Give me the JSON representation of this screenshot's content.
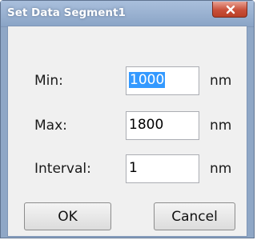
{
  "dialog": {
    "title": "Set Data Segment1",
    "close_label": "×"
  },
  "fields": {
    "min": {
      "label": "Min:",
      "value": "1000",
      "unit": "nm"
    },
    "max": {
      "label": "Max:",
      "value": "1800",
      "unit": "nm"
    },
    "interval": {
      "label": "Interval:",
      "value": "1",
      "unit": "nm"
    }
  },
  "buttons": {
    "ok_label": "OK",
    "cancel_label": "Cancel"
  },
  "colors": {
    "selection": "#3399ff",
    "close_button": "#c9503a",
    "title_bar": "#8fa7c6"
  },
  "icons": {
    "close": "close-icon"
  }
}
